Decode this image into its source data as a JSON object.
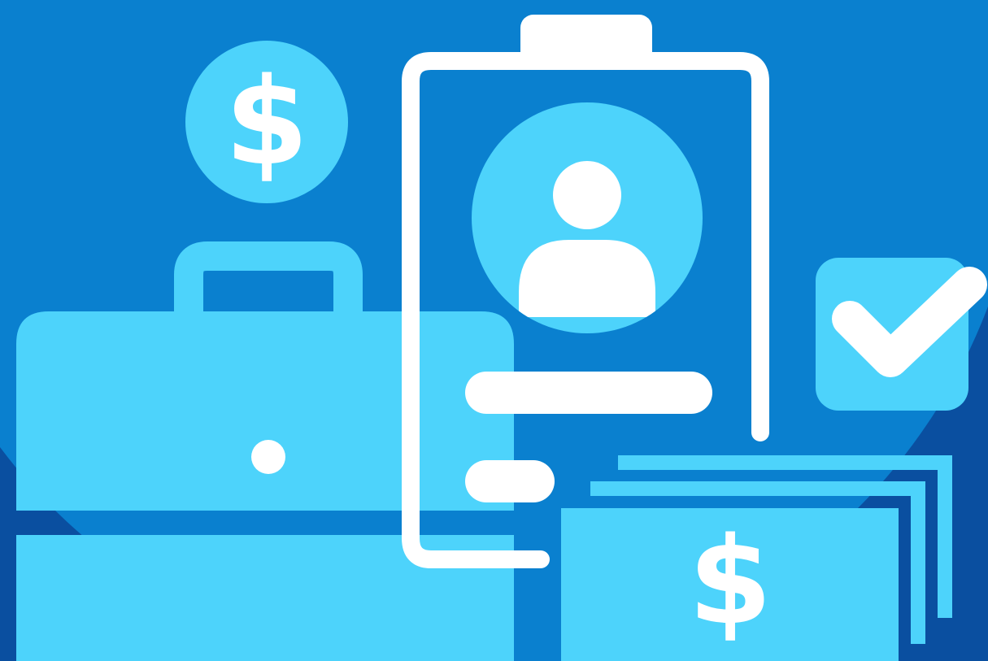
{
  "illustration": {
    "colors": {
      "background_dark": "#0A4FA0",
      "background_mid": "#0A80CF",
      "accent_light": "#4DD3FB",
      "white": "#FFFFFF"
    },
    "icons": {
      "coin": "dollar-coin-icon",
      "briefcase": "briefcase-icon",
      "clipboard": "clipboard-profile-icon",
      "avatar": "user-avatar-icon",
      "checkbox": "checkmark-icon",
      "money": "banknote-stack-icon"
    },
    "coin_symbol": "$",
    "money_symbol": "$"
  }
}
